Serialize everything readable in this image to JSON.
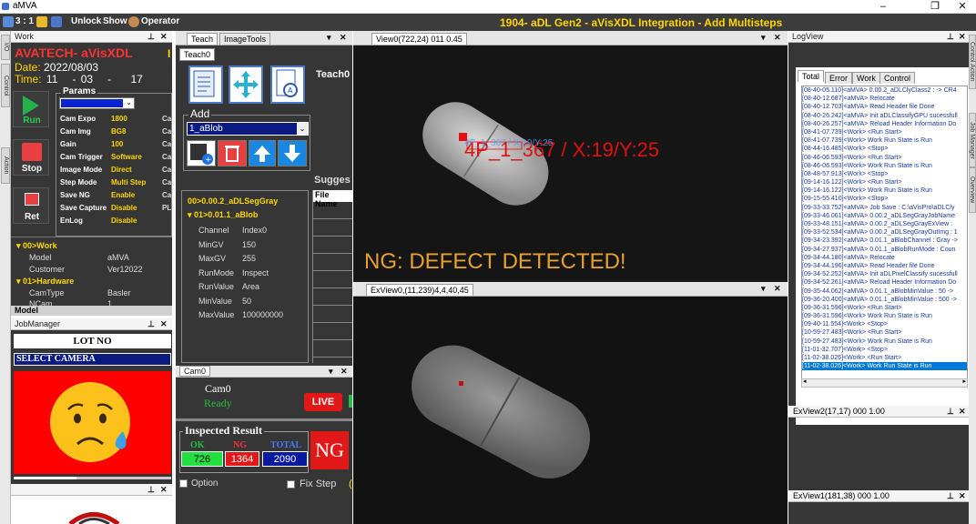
{
  "window": {
    "title": "aMVA",
    "app_title": "1904- aDL Gen2  - aVisXDL Integration - Add Multisteps",
    "minimize": "–",
    "maximize": "❐",
    "close": "✕"
  },
  "toolbar": {
    "counter": "3 : 1",
    "unlock": "Unlock",
    "show": "Show",
    "operator": "Operator"
  },
  "left_tabs": [
    "I/O",
    "Control",
    "Action"
  ],
  "work": {
    "panel_title": "Work",
    "title": "AVATECH- aVisXDL",
    "marker": "I",
    "date_label": "Date:",
    "date_value": "2022/08/03",
    "time_label": "Time:",
    "time_h": "11",
    "time_sep1": "-",
    "time_m": "03",
    "time_sep2": "-",
    "time_s": "17",
    "run": "Run",
    "stop": "Stop",
    "ret": "Ret",
    "params_title": "Params",
    "params": [
      {
        "label": "Cam Expo",
        "value": "1800",
        "ca": "Ca"
      },
      {
        "label": "Cam Img",
        "value": "BG8",
        "ca": "Ca"
      },
      {
        "label": "Gain",
        "value": "100",
        "ca": "Ca"
      },
      {
        "label": "Cam Trigger",
        "value": "Software",
        "ca": "Ca"
      },
      {
        "label": "Image Mode",
        "value": "Direct",
        "ca": "Ca"
      },
      {
        "label": "Step Mode",
        "value": "Multi Step",
        "ca": "Ca"
      },
      {
        "label": "Save NG",
        "value": "Enable",
        "ca": "Ca"
      },
      {
        "label": "Save Capture",
        "value": "Disable",
        "ca": "PL"
      },
      {
        "label": "EnLog",
        "value": "Disable",
        "ca": ""
      }
    ],
    "tree": {
      "work_node": "00>Work",
      "model_label": "Model",
      "model_value": "aMVA",
      "customer_label": "Customer",
      "customer_value": "Ver12022",
      "hw_node": "01>Hardware",
      "camtype_label": "CamType",
      "camtype_value": "Basler",
      "ncam_label": "NCam",
      "ncam_value": "1"
    },
    "footer": "Model"
  },
  "job": {
    "panel_title": "JobManager",
    "lot_no": "LOT NO",
    "select_camera": "SELECT CAMERA"
  },
  "teach": {
    "tab_teach": "Teach",
    "tab_imagetools": "ImageTools",
    "subtab": "Teach0",
    "label_teach0": "Teach0",
    "add": "Add",
    "add_value": "1_aBlob",
    "suggest": "Sugges",
    "file_name": "File Name",
    "tree": [
      {
        "text": "00>0.00.2_aDLSegGray",
        "color": "yellow"
      },
      {
        "text": "01>0.01.1_aBlob",
        "color": "yellow"
      }
    ],
    "props": [
      {
        "label": "Channel",
        "value": "Index0"
      },
      {
        "label": "MinGV",
        "value": "150"
      },
      {
        "label": "MaxGV",
        "value": "255"
      },
      {
        "label": "RunMode",
        "value": "Inspect"
      },
      {
        "label": "RunValue",
        "value": "Area"
      },
      {
        "label": "MinValue",
        "value": "50"
      },
      {
        "label": "MaxValue",
        "value": "100000000"
      }
    ]
  },
  "cam": {
    "panel_title": "Cam0",
    "name": "Cam0",
    "status": "Ready",
    "live": "LIVE",
    "inspected_title": "Inspected Result",
    "ok_label": "OK",
    "ng_label": "NG",
    "total_label": "TOTAL",
    "ok_value": "726",
    "ng_value": "1364",
    "total_value": "2090",
    "ng_badge": "NG",
    "option": "Option",
    "fix_step": "Fix Step"
  },
  "views": {
    "view0_title": "View0(722,24) 011 0.45",
    "overlay": "4P_1_367 / X:19/Y:25",
    "overlay_small": "4P_1_367 / X:19/Y:25",
    "ng_message": "NG: DEFECT DETECTED!",
    "exview0_title": "ExView0,(11,239)4,4,40,45"
  },
  "log": {
    "panel_title": "LogView",
    "tabs": [
      "Total",
      "Error",
      "Work",
      "Control"
    ],
    "lines": [
      "[08-40-05.110]<aMVA> 0.00.2_aDLClyClass2 : -> CR4",
      "[08-40-12.687]<aMVA> Relocate",
      "[08-40-12.703]<aMVA> Read Header file Done",
      "[08-40-26.242]<aMVA> Init aDLClassifyGPU sucessfull",
      "[08-40-26.257]<aMVA> Reload Header Information Do",
      "[08-41-07.739]<Work> <Run Start>",
      "[08-41-07.739]<Work> Work Run State is Run",
      "[08-44-16.485]<Work> <Stop>",
      "[08-46-06.593]<Work> <Run Start>",
      "[08-46-06.593]<Work> Work Run State is Run",
      "[08-48-57.913]<Work> <Stop>",
      "[09-14-16.122]<Work> <Run Start>",
      "[09-14-16.122]<Work> Work Run State is Run",
      "[09-15-55.410]<Work> <Stop>",
      "[09-33-33.752]<aMVA> Job Save : C:\\aVisPro\\aDLCly",
      "[09-33-46.061]<aMVA> 0.00.2_aDLSegGrayJobName",
      "[09-33-48.151]<aMVA> 0.00.2_aDLSegGrayExView :",
      "[09-33-52.534]<aMVA> 0.00.2_aDLSegGrayOutImg : 1",
      "[09-34-23.392]<aMVA> 0.01.1_aBlobChannel : Gray ->",
      "[09-34-27.937]<aMVA> 0.01.1_aBlobRunMode : Coun",
      "[09-34-44.180]<aMVA> Relocate",
      "[09-34-44.196]<aMVA> Read Header file Done",
      "[09-34-52.252]<aMVA> Init aDLPixelClassify sucessfull",
      "[09-34-52.261]<aMVA> Reload Header Information Do",
      "[09-35-44.062]<aMVA> 0.01.1_aBlobMinValue : 50 ->",
      "[09-36-20.400]<aMVA> 0.01.1_aBlobMinValue : 500 ->",
      "[09-36-31.596]<Work> <Run Start>",
      "[09-36-31.596]<Work> Work Run State is Run",
      "[09-40-11.554]<Work> <Stop>",
      "[10-59-27.483]<Work> <Run Start>",
      "[10-59-27.483]<Work> Work Run State is Run",
      "[11-01-32.707]<Work> <Stop>",
      "[11-02-38.026]<Work> <Run Start>",
      "[11-02-38.026]<Work> Work Run State is Run"
    ],
    "exview2_title": "ExView2(17,17) 000 1.00",
    "exview1_title": "ExView1(181,38) 000 1.00"
  },
  "right_tabs": [
    "Control Action",
    "Job Manager",
    "Overview"
  ],
  "colors": {
    "panel_bg": "#363636",
    "yellow": "#ffd700",
    "red": "#ff3232",
    "select_blue": "#0078d7"
  }
}
